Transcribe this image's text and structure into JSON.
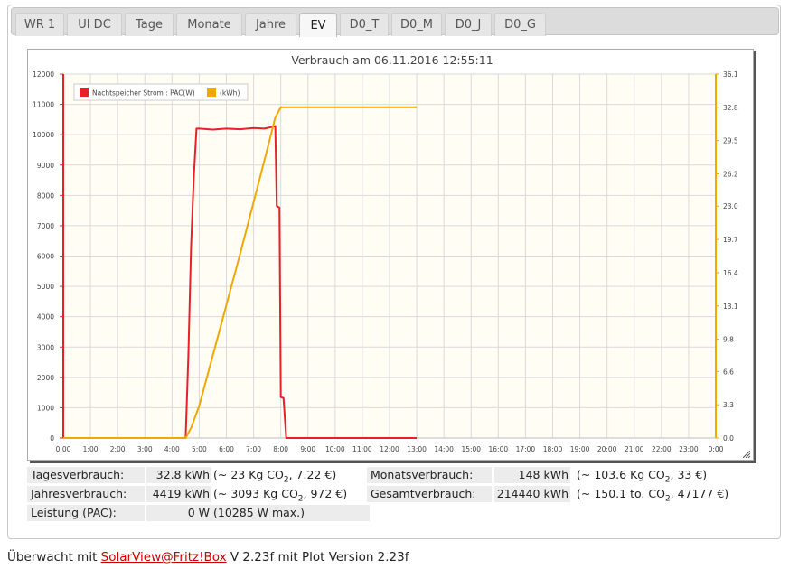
{
  "tabs": [
    {
      "label": "WR 1",
      "active": false
    },
    {
      "label": "UI DC",
      "active": false
    },
    {
      "label": "Tage",
      "active": false
    },
    {
      "label": "Monate",
      "active": false
    },
    {
      "label": "Jahre",
      "active": false
    },
    {
      "label": "EV",
      "active": true
    },
    {
      "label": "D0_T",
      "active": false
    },
    {
      "label": "D0_M",
      "active": false
    },
    {
      "label": "D0_J",
      "active": false
    },
    {
      "label": "D0_G",
      "active": false
    }
  ],
  "chart_data": {
    "type": "line",
    "title": "Verbrauch am 06.11.2016 12:55:11",
    "x_ticks": [
      "0:00",
      "1:00",
      "2:00",
      "3:00",
      "4:00",
      "5:00",
      "6:00",
      "7:00",
      "8:00",
      "9:00",
      "10:00",
      "11:00",
      "12:00",
      "13:00",
      "14:00",
      "15:00",
      "16:00",
      "17:00",
      "18:00",
      "19:00",
      "20:00",
      "21:00",
      "22:00",
      "23:00",
      "0:00"
    ],
    "y_left_ticks": [
      0,
      1000,
      2000,
      3000,
      4000,
      5000,
      6000,
      7000,
      8000,
      9000,
      10000,
      11000,
      12000
    ],
    "y_right_ticks": [
      "0.0",
      "3.3",
      "6.6",
      "9.8",
      "13.1",
      "16.4",
      "19.7",
      "23.0",
      "26.2",
      "29.5",
      "32.8",
      "36.1"
    ],
    "ylim_left": [
      0,
      12000
    ],
    "ylim_right": [
      0,
      36.1
    ],
    "xlim_hours": [
      0,
      24
    ],
    "grid": true,
    "legend_position": "top-left",
    "series": [
      {
        "name": "Nachtspeicher Strom : PAC(W)",
        "color": "#e8202a",
        "axis": "left",
        "points": [
          [
            0,
            0
          ],
          [
            4.5,
            0
          ],
          [
            4.6,
            2700
          ],
          [
            4.7,
            6300
          ],
          [
            4.8,
            8600
          ],
          [
            4.9,
            10200
          ],
          [
            5.0,
            10200
          ],
          [
            5.5,
            10170
          ],
          [
            6.0,
            10200
          ],
          [
            6.5,
            10180
          ],
          [
            7.0,
            10220
          ],
          [
            7.4,
            10200
          ],
          [
            7.7,
            10260
          ],
          [
            7.8,
            10285
          ],
          [
            7.85,
            7650
          ],
          [
            7.95,
            7600
          ],
          [
            8.0,
            1350
          ],
          [
            8.1,
            1320
          ],
          [
            8.2,
            0
          ],
          [
            13.0,
            0
          ]
        ]
      },
      {
        "name": "(kWh)",
        "color": "#f0a800",
        "axis": "right",
        "points": [
          [
            0,
            0
          ],
          [
            4.5,
            0
          ],
          [
            4.7,
            1.0
          ],
          [
            5.0,
            3.2
          ],
          [
            5.5,
            8.2
          ],
          [
            6.0,
            13.2
          ],
          [
            6.5,
            18.2
          ],
          [
            7.0,
            23.4
          ],
          [
            7.5,
            28.6
          ],
          [
            7.8,
            31.8
          ],
          [
            8.0,
            32.8
          ],
          [
            13.0,
            32.8
          ]
        ]
      }
    ]
  },
  "stats": {
    "tages_label": "Tagesverbrauch:",
    "tages_value": "32.8 kWh",
    "tages_extra_a": "(~ 23 Kg CO",
    "tages_extra_sub": "2",
    "tages_extra_b": ", 7.22 €)",
    "monats_label": "Monatsverbrauch:",
    "monats_value": "148 kWh",
    "monats_extra_a": "(~ 103.6 Kg CO",
    "monats_extra_sub": "2",
    "monats_extra_b": ", 33 €)",
    "jahres_label": "Jahresverbrauch:",
    "jahres_value": "4419 kWh",
    "jahres_extra_a": "(~ 3093 Kg CO",
    "jahres_extra_sub": "2",
    "jahres_extra_b": ", 972 €)",
    "gesamt_label": "Gesamtverbrauch:",
    "gesamt_value": "214440 kWh",
    "gesamt_extra_a": "(~ 150.1 to. CO",
    "gesamt_extra_sub": "2",
    "gesamt_extra_b": ", 47177 €)",
    "leistung_label": "Leistung (PAC):",
    "leistung_value": "0 W",
    "leistung_extra": "(10285 W max.)"
  },
  "footer": {
    "prefix": "Überwacht mit ",
    "link": "SolarView@Fritz!Box",
    "suffix": " V 2.23f mit Plot Version 2.23f"
  }
}
